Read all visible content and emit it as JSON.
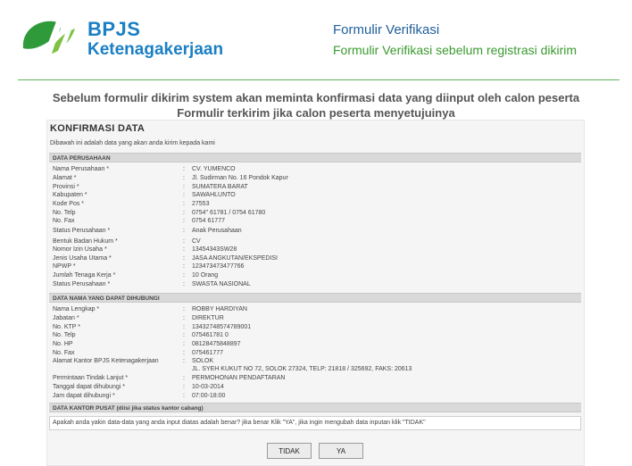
{
  "header": {
    "brand": "BPJS",
    "brand_sub": "Ketenagakerjaan",
    "title": "Formulir  Verifikasi",
    "subtitle": "Formulir Verifikasi  sebelum registrasi dikirim"
  },
  "note": {
    "line1": "Sebelum formulir dikirim system akan meminta konfirmasi data yang diinput oleh calon peserta",
    "line2": "Formulir terkirim jika calon peserta menyetujuinya"
  },
  "form": {
    "title": "KONFIRMASI DATA",
    "desc": "Dibawah ini adalah data yang akan anda kirim kepada kami",
    "sections": {
      "perusahaan": "DATA PERUSAHAAN",
      "kontak": "DATA NAMA YANG DAPAT DIHUBUNGI",
      "pusat": "DATA KANTOR PUSAT (diisi jika status kantor cabang)"
    },
    "perusahaan_rows": [
      {
        "label": "Nama Perusahaan *",
        "value": "CV. YUMENCO"
      },
      {
        "label": "Alamat *",
        "value": "Jl. Sudirman No. 16 Pondok Kapur"
      },
      {
        "label": "Provinsi *",
        "value": "SUMATERA BARAT"
      },
      {
        "label": "Kabupaten *",
        "value": "SAWAHLUNTO"
      },
      {
        "label": "Kode Pos *",
        "value": "27553"
      },
      {
        "label": "No. Telp",
        "value": "0754\" 61781 / 0754 61780"
      },
      {
        "label": "No. Fax",
        "value": "0754 61777"
      },
      {
        "label": "Status Perusahaan *",
        "value": " Anak Perusahaan"
      },
      {
        "label": "Bentuk Badan Hukum *",
        "value": "CV"
      },
      {
        "label": "Nomor Izin Usaha *",
        "value": "13454343SW28"
      },
      {
        "label": "Jenis Usaha Utama *",
        "value": "JASA ANGKUTAN/EKSPEDISI"
      },
      {
        "label": "NPWP *",
        "value": "123473473477766"
      },
      {
        "label": "Jumlah Tenaga Kerja *",
        "value": "10 Orang"
      },
      {
        "label": "Status Perusahaan *",
        "value": " SWASTA NASIONAL"
      }
    ],
    "kontak_rows": [
      {
        "label": "Nama Lengkap *",
        "value": "ROBBY HARDIYAN"
      },
      {
        "label": "Jabatan *",
        "value": "DIREKTUR"
      },
      {
        "label": "No. KTP *",
        "value": "13432748574789001"
      },
      {
        "label": "No. Telp",
        "value": "075461781 0"
      },
      {
        "label": "No. HP",
        "value": "08128475848897"
      },
      {
        "label": "No. Fax",
        "value": "075461777"
      },
      {
        "label": "Alamat Kantor BPJS Ketenagakerjaan",
        "value": "SOLOK",
        "value2": "JL. SYEH KUKUT NO 72, SOLOK 27324, TELP: 21818 / 325692, FAKS: 20613"
      },
      {
        "label": "Permintaan Tindak Lanjut *",
        "value": "PERMOHONAN PENDAFTARAN"
      },
      {
        "label": "Tanggal dapat dihubungi *",
        "value": "10-03-2014"
      },
      {
        "label": "Jam dapat dihubungi *",
        "value": "07:00-18:00"
      }
    ],
    "confirm_text": "Apakah anda yakin data-data yang anda input diatas adalah benar? jika benar Klik \"YA\", jika ingin mengubah data inputan klik \"TIDAK\"",
    "btn_no": "TIDAK",
    "btn_yes": "YA"
  },
  "colors": {
    "brand_blue": "#1a7fc4",
    "brand_green": "#3a9a2f",
    "title_blue": "#1f5f99"
  }
}
